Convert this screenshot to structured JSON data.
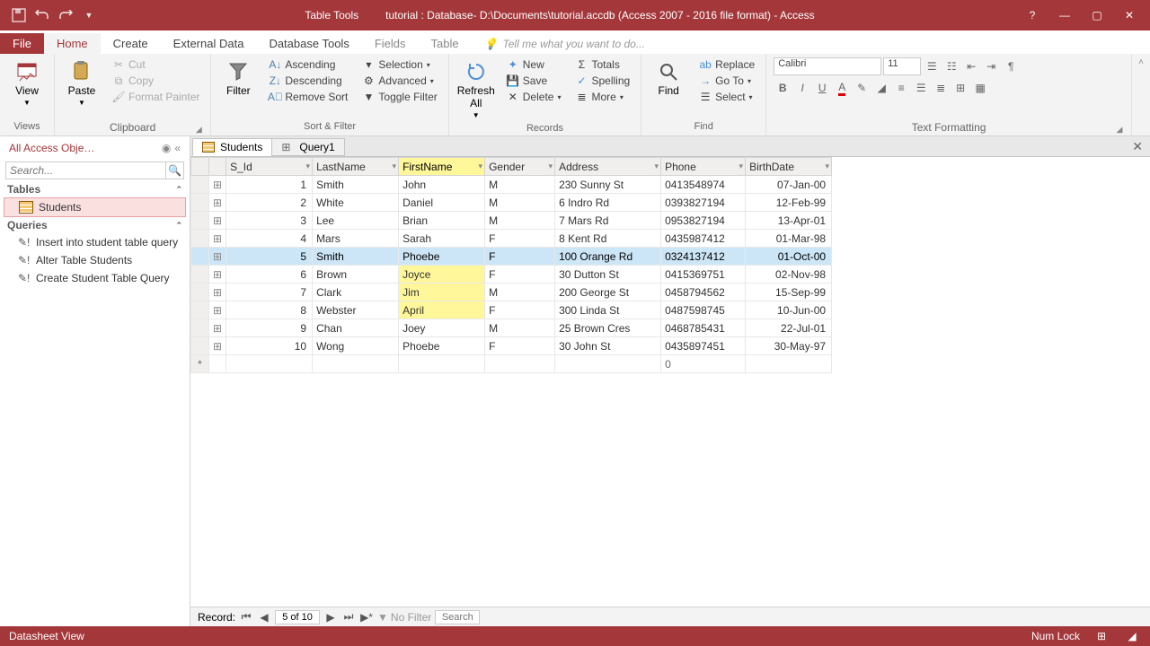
{
  "titlebar": {
    "table_tools": "Table Tools",
    "title": "tutorial : Database- D:\\Documents\\tutorial.accdb (Access 2007 - 2016 file format) - Access"
  },
  "tabs": {
    "file": "File",
    "home": "Home",
    "create": "Create",
    "external_data": "External Data",
    "database_tools": "Database Tools",
    "fields": "Fields",
    "table": "Table",
    "tell_me": "Tell me what you want to do..."
  },
  "ribbon": {
    "views": {
      "view": "View",
      "label": "Views"
    },
    "clipboard": {
      "paste": "Paste",
      "cut": "Cut",
      "copy": "Copy",
      "format_painter": "Format Painter",
      "label": "Clipboard"
    },
    "sort_filter": {
      "filter": "Filter",
      "ascending": "Ascending",
      "descending": "Descending",
      "remove_sort": "Remove Sort",
      "selection": "Selection",
      "advanced": "Advanced",
      "toggle_filter": "Toggle Filter",
      "label": "Sort & Filter"
    },
    "records": {
      "refresh_all": "Refresh\nAll",
      "new": "New",
      "save": "Save",
      "delete": "Delete",
      "totals": "Totals",
      "spelling": "Spelling",
      "more": "More",
      "label": "Records"
    },
    "find": {
      "find": "Find",
      "replace": "Replace",
      "go_to": "Go To",
      "select": "Select",
      "label": "Find"
    },
    "text_formatting": {
      "font": "Calibri",
      "size": "11",
      "label": "Text Formatting"
    }
  },
  "nav": {
    "header": "All Access Obje…",
    "search_placeholder": "Search...",
    "tables": "Tables",
    "queries": "Queries",
    "table_students": "Students",
    "q1": "Insert into student table query",
    "q2": "Alter Table Students",
    "q3": "Create Student Table Query"
  },
  "doc_tabs": {
    "students": "Students",
    "query1": "Query1"
  },
  "columns": [
    "S_Id",
    "LastName",
    "FirstName",
    "Gender",
    "Address",
    "Phone",
    "BirthDate"
  ],
  "highlighted_column_index": 2,
  "selected_row_index": 4,
  "highlight_cells": [
    [
      5,
      2
    ],
    [
      6,
      2
    ],
    [
      7,
      2
    ]
  ],
  "rows": [
    {
      "id": "1",
      "last": "Smith",
      "first": "John",
      "gender": "M",
      "addr": "230 Sunny St",
      "phone": "0413548974",
      "birth": "07-Jan-00"
    },
    {
      "id": "2",
      "last": "White",
      "first": "Daniel",
      "gender": "M",
      "addr": "6 Indro Rd",
      "phone": "0393827194",
      "birth": "12-Feb-99"
    },
    {
      "id": "3",
      "last": "Lee",
      "first": "Brian",
      "gender": "M",
      "addr": "7 Mars Rd",
      "phone": "0953827194",
      "birth": "13-Apr-01"
    },
    {
      "id": "4",
      "last": "Mars",
      "first": "Sarah",
      "gender": "F",
      "addr": "8 Kent Rd",
      "phone": "0435987412",
      "birth": "01-Mar-98"
    },
    {
      "id": "5",
      "last": "Smith",
      "first": "Phoebe",
      "gender": "F",
      "addr": "100 Orange Rd",
      "phone": "0324137412",
      "birth": "01-Oct-00"
    },
    {
      "id": "6",
      "last": "Brown",
      "first": "Joyce",
      "gender": "F",
      "addr": "30 Dutton St",
      "phone": "0415369751",
      "birth": "02-Nov-98"
    },
    {
      "id": "7",
      "last": "Clark",
      "first": "Jim",
      "gender": "M",
      "addr": "200 George St",
      "phone": "0458794562",
      "birth": "15-Sep-99"
    },
    {
      "id": "8",
      "last": "Webster",
      "first": "April",
      "gender": "F",
      "addr": "300 Linda St",
      "phone": "0487598745",
      "birth": "10-Jun-00"
    },
    {
      "id": "9",
      "last": "Chan",
      "first": "Joey",
      "gender": "M",
      "addr": "25 Brown Cres",
      "phone": "0468785431",
      "birth": "22-Jul-01"
    },
    {
      "id": "10",
      "last": "Wong",
      "first": "Phoebe",
      "gender": "F",
      "addr": "30 John St",
      "phone": "0435897451",
      "birth": "30-May-97"
    }
  ],
  "new_row_phone": "0",
  "record_nav": {
    "label": "Record:",
    "position": "5 of 10",
    "no_filter": "No Filter",
    "search": "Search"
  },
  "status": {
    "view": "Datasheet View",
    "numlock": "Num Lock"
  }
}
